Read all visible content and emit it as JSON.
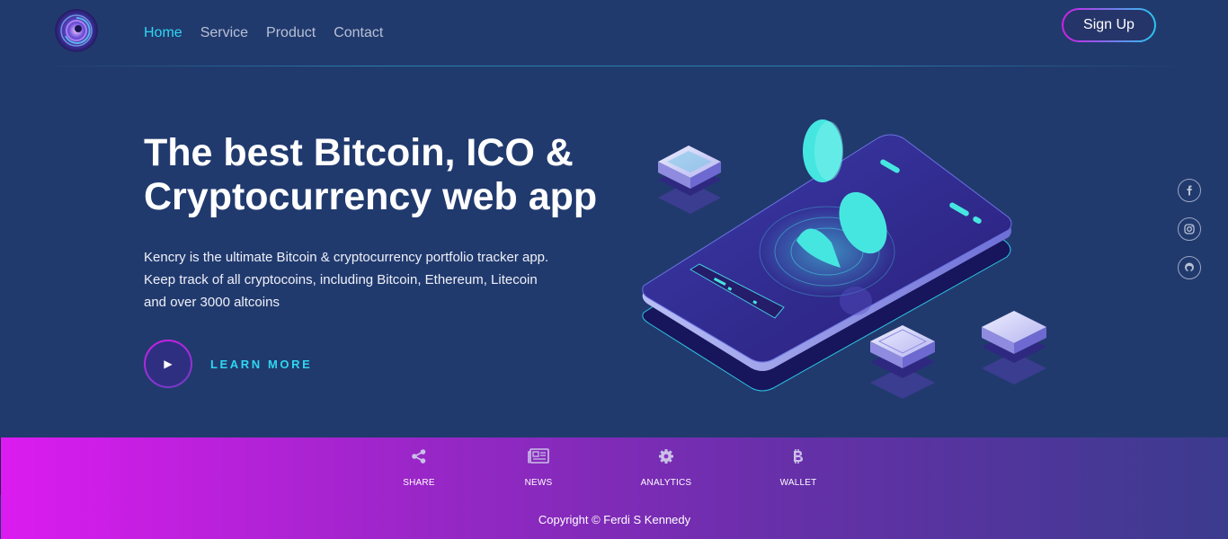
{
  "nav": {
    "items": [
      {
        "label": "Home",
        "active": true
      },
      {
        "label": "Service",
        "active": false
      },
      {
        "label": "Product",
        "active": false
      },
      {
        "label": "Contact",
        "active": false
      }
    ],
    "signup_label": "Sign Up"
  },
  "hero": {
    "title_line1": "The best Bitcoin, ICO &",
    "title_line2": "Cryptocurrency web app",
    "desc_line1": "Kencry is the ultimate Bitcoin & cryptocurrency portfolio tracker app.",
    "desc_line2": "Keep track of all cryptocoins, including Bitcoin, Ethereum, Litecoin",
    "desc_line3": "and over 3000 altcoins",
    "cta_label": "LEARN MORE"
  },
  "social": {
    "icons": [
      "facebook-icon",
      "instagram-icon",
      "github-icon"
    ]
  },
  "footer": {
    "items": [
      {
        "label": "SHARE",
        "icon": "share-icon"
      },
      {
        "label": "NEWS",
        "icon": "news-icon"
      },
      {
        "label": "ANALYTICS",
        "icon": "gear-icon"
      },
      {
        "label": "WALLET",
        "icon": "bitcoin-icon"
      }
    ],
    "copyright": "Copyright © Ferdi S Kennedy"
  },
  "colors": {
    "background": "#213a6e",
    "accent_cyan": "#2fd6f0",
    "accent_magenta": "#d21ee6",
    "footer_gradient_start": "#dc1bf0",
    "footer_gradient_end": "#3b3b8e"
  }
}
